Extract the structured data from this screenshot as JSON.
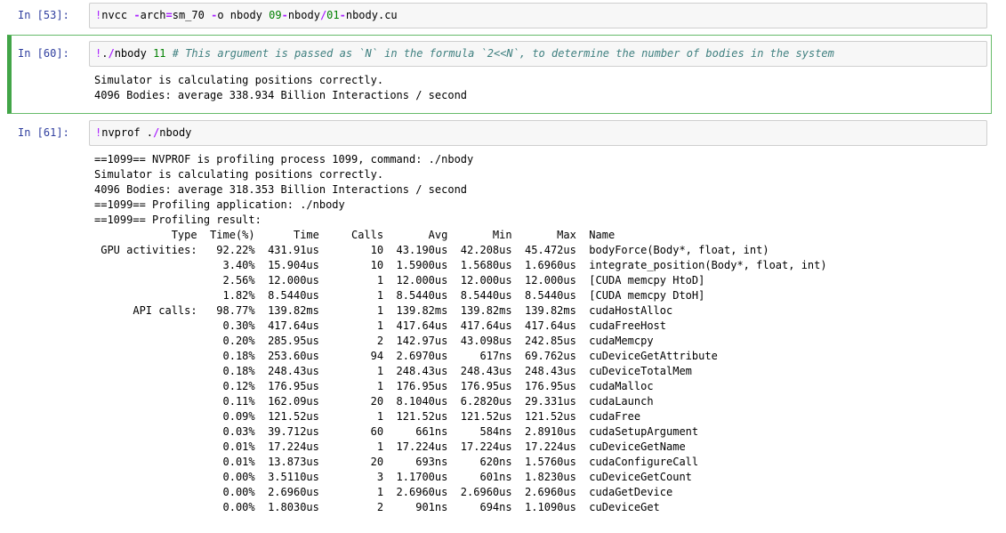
{
  "cells": [
    {
      "prompt": "In  [53]:",
      "code_parts": [
        {
          "t": "!",
          "c": "bang"
        },
        {
          "t": "nvcc ",
          "c": ""
        },
        {
          "t": "-",
          "c": "op"
        },
        {
          "t": "arch",
          "c": ""
        },
        {
          "t": "=",
          "c": "op"
        },
        {
          "t": "sm_70 ",
          "c": ""
        },
        {
          "t": "-",
          "c": "op"
        },
        {
          "t": "o nbody ",
          "c": ""
        },
        {
          "t": "09",
          "c": "num"
        },
        {
          "t": "-",
          "c": "op"
        },
        {
          "t": "nbody",
          "c": ""
        },
        {
          "t": "/",
          "c": "op"
        },
        {
          "t": "01",
          "c": "num"
        },
        {
          "t": "-",
          "c": "op"
        },
        {
          "t": "nbody.cu",
          "c": ""
        }
      ]
    },
    {
      "prompt": "In  [60]:",
      "code_parts": [
        {
          "t": "!",
          "c": "bang"
        },
        {
          "t": ".",
          "c": ""
        },
        {
          "t": "/",
          "c": "op"
        },
        {
          "t": "nbody ",
          "c": ""
        },
        {
          "t": "11",
          "c": "num"
        },
        {
          "t": " ",
          "c": ""
        },
        {
          "t": "# This argument is passed as `N` in the formula `2<<N`, to determine the number of bodies in the system",
          "c": "cm"
        }
      ],
      "output": "Simulator is calculating positions correctly.\n4096 Bodies: average 338.934 Billion Interactions / second"
    },
    {
      "prompt": "In  [61]:",
      "code_parts": [
        {
          "t": "!",
          "c": "bang"
        },
        {
          "t": "nvprof .",
          "c": ""
        },
        {
          "t": "/",
          "c": "op"
        },
        {
          "t": "nbody",
          "c": ""
        }
      ],
      "output": "==1099== NVPROF is profiling process 1099, command: ./nbody\nSimulator is calculating positions correctly.\n4096 Bodies: average 318.353 Billion Interactions / second\n==1099== Profiling application: ./nbody\n==1099== Profiling result:\n            Type  Time(%)      Time     Calls       Avg       Min       Max  Name\n GPU activities:   92.22%  431.91us        10  43.190us  42.208us  45.472us  bodyForce(Body*, float, int)\n                    3.40%  15.904us        10  1.5900us  1.5680us  1.6960us  integrate_position(Body*, float, int)\n                    2.56%  12.000us         1  12.000us  12.000us  12.000us  [CUDA memcpy HtoD]\n                    1.82%  8.5440us         1  8.5440us  8.5440us  8.5440us  [CUDA memcpy DtoH]\n      API calls:   98.77%  139.82ms         1  139.82ms  139.82ms  139.82ms  cudaHostAlloc\n                    0.30%  417.64us         1  417.64us  417.64us  417.64us  cudaFreeHost\n                    0.20%  285.95us         2  142.97us  43.098us  242.85us  cudaMemcpy\n                    0.18%  253.60us        94  2.6970us     617ns  69.762us  cuDeviceGetAttribute\n                    0.18%  248.43us         1  248.43us  248.43us  248.43us  cuDeviceTotalMem\n                    0.12%  176.95us         1  176.95us  176.95us  176.95us  cudaMalloc\n                    0.11%  162.09us        20  8.1040us  6.2820us  29.331us  cudaLaunch\n                    0.09%  121.52us         1  121.52us  121.52us  121.52us  cudaFree\n                    0.03%  39.712us        60     661ns     584ns  2.8910us  cudaSetupArgument\n                    0.01%  17.224us         1  17.224us  17.224us  17.224us  cuDeviceGetName\n                    0.01%  13.873us        20     693ns     620ns  1.5760us  cudaConfigureCall\n                    0.00%  3.5110us         3  1.1700us     601ns  1.8230us  cuDeviceGetCount\n                    0.00%  2.6960us         1  2.6960us  2.6960us  2.6960us  cudaGetDevice\n                    0.00%  1.8030us         2     901ns     694ns  1.1090us  cuDeviceGet"
    }
  ],
  "colors": {
    "prompt": "#303f9f",
    "selected_border": "#42a548",
    "input_bg": "#f7f7f7"
  }
}
